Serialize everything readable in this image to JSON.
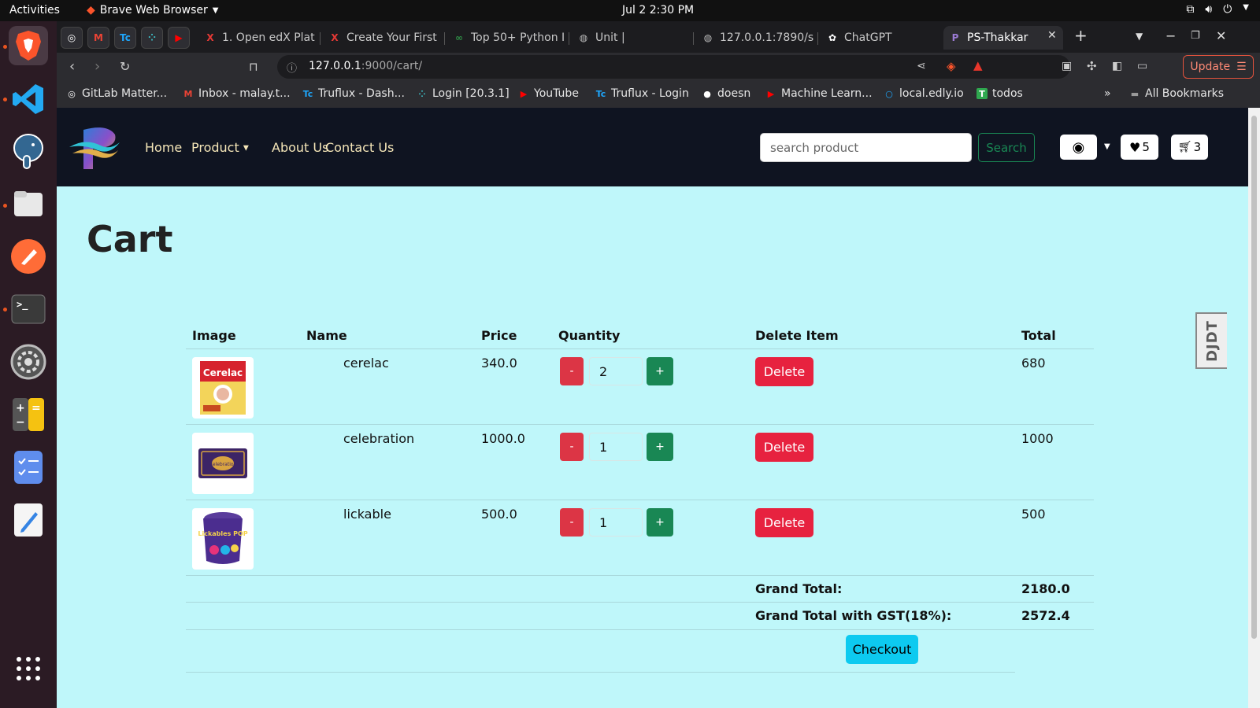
{
  "system": {
    "activities": "Activities",
    "app_name": "Brave Web Browser",
    "clock": "Jul 2  2:30 PM"
  },
  "tabs": [
    {
      "label": "1. Open edX Plat",
      "icon": "x-icon"
    },
    {
      "label": "Create Your First",
      "icon": "x-icon"
    },
    {
      "label": "Top 50+ Python I",
      "icon": "link-icon"
    },
    {
      "label": "Unit |",
      "icon": "globe-icon"
    },
    {
      "label": "127.0.0.1:7890/s",
      "icon": "globe-icon"
    },
    {
      "label": "ChatGPT",
      "icon": "chatgpt-icon"
    },
    {
      "label": "PS-Thakkar",
      "icon": "ps-icon",
      "active": true
    }
  ],
  "address": {
    "host": "127.0.0.1",
    "rest": ":9000/cart/"
  },
  "update_label": "Update",
  "bookmarks": [
    "GitLab Matter...",
    "Inbox - malay.t...",
    "Truflux - Dash...",
    "Login [20.3.1]",
    "YouTube",
    "Truflux - Login",
    "doesn",
    "Machine Learn...",
    "local.edly.io",
    "todos"
  ],
  "bookmarks_more": "»",
  "all_bookmarks": "All Bookmarks",
  "site": {
    "nav": [
      "Home",
      "Product",
      "About Us",
      "Contact Us"
    ],
    "search_placeholder": "search product",
    "search_button": "Search",
    "wishlist_count": "5",
    "cart_count": "3"
  },
  "cart": {
    "title": "Cart",
    "headers": [
      "Image",
      "Name",
      "Price",
      "Quantity",
      "Delete Item",
      "Total"
    ],
    "items": [
      {
        "name": "cerelac",
        "price": "340.0",
        "qty": "2",
        "total": "680",
        "thumb_text": "Cerelac"
      },
      {
        "name": "celebration",
        "price": "1000.0",
        "qty": "1",
        "total": "1000",
        "thumb_text": "Celebration"
      },
      {
        "name": "lickable",
        "price": "500.0",
        "qty": "1",
        "total": "500",
        "thumb_text": "Lickables POP"
      }
    ],
    "minus": "-",
    "plus": "+",
    "delete_label": "Delete",
    "grand_total_label": "Grand Total:",
    "grand_total": "2180.0",
    "grand_total_gst_label": "Grand Total with GST(18%):",
    "grand_total_gst": "2572.4",
    "checkout_label": "Checkout"
  },
  "djdt": "DJDT"
}
